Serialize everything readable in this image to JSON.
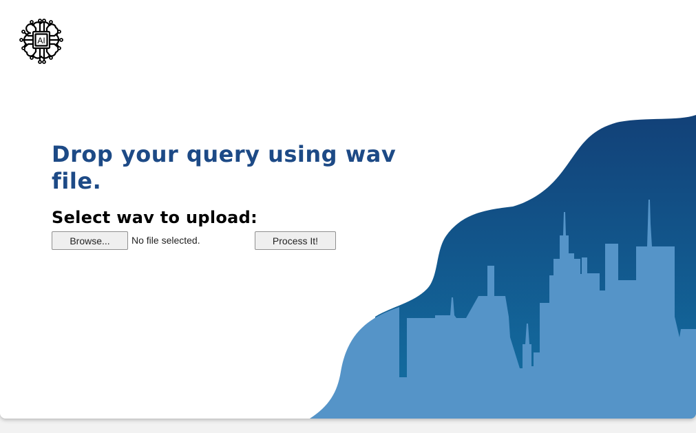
{
  "logo": {
    "text": "AI",
    "icon": "ai-chip-icon"
  },
  "hero": {
    "headline": "Drop your query using wav file."
  },
  "upload": {
    "label": "Select wav to upload:",
    "browse_label": "Browse...",
    "file_status": "No file selected.",
    "submit_label": "Process It!"
  },
  "colors": {
    "headline": "#1d4a86",
    "wave_top": "#124178",
    "wave_bottom": "#1371a4",
    "city": "#5594c8"
  }
}
